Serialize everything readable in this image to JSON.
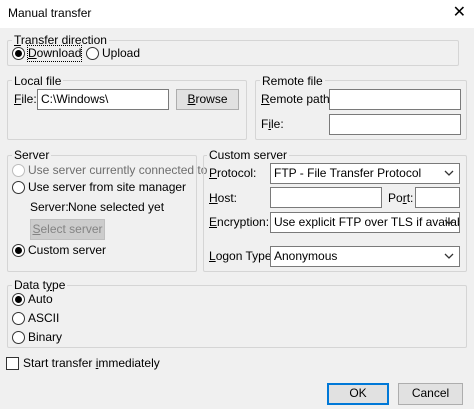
{
  "window": {
    "title": "Manual transfer"
  },
  "direction": {
    "legend": "Transfer direction",
    "download_label": "Download",
    "upload_label": "Upload",
    "selected": "download"
  },
  "local": {
    "legend": "Local file",
    "file_label": "File:",
    "file_value": "C:\\Windows\\",
    "browse_label": "Browse"
  },
  "remote": {
    "legend": "Remote file",
    "path_label": "Remote path:",
    "path_value": "",
    "file_label": "File:",
    "file_value": ""
  },
  "server": {
    "legend": "Server",
    "use_connected_label": "Use server currently connected to",
    "use_site_manager_label": "Use server from site manager",
    "server_label": "Server:",
    "server_value": "None selected yet",
    "select_server_label": "Select server",
    "custom_label": "Custom server",
    "selected": "custom"
  },
  "custom": {
    "legend": "Custom server",
    "protocol_label": "Protocol:",
    "protocol_value": "FTP - File Transfer Protocol",
    "host_label": "Host:",
    "host_value": "",
    "port_label": "Port:",
    "port_value": "",
    "encryption_label": "Encryption:",
    "encryption_value": "Use explicit FTP over TLS if available",
    "logon_label": "Logon Type:",
    "logon_value": "Anonymous"
  },
  "datatype": {
    "legend": "Data type",
    "auto_label": "Auto",
    "ascii_label": "ASCII",
    "binary_label": "Binary",
    "selected": "auto"
  },
  "start_immediately_label": "Start transfer immediately",
  "buttons": {
    "ok": "OK",
    "cancel": "Cancel"
  }
}
